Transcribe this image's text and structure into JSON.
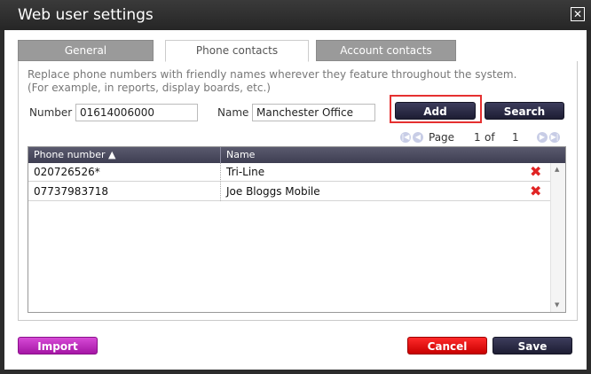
{
  "window": {
    "title": "Web user settings",
    "close_glyph": "☒"
  },
  "tabs": [
    {
      "label": "General"
    },
    {
      "label": "Phone contacts"
    },
    {
      "label": "Account contacts"
    }
  ],
  "intro": {
    "line1": "Replace phone numbers with friendly names wherever they feature throughout the system.",
    "line2": "(For example, in reports, display boards, etc.)"
  },
  "form": {
    "number_label": "Number",
    "number_value": "01614006000",
    "name_label": "Name",
    "name_value": "Manchester Office",
    "add_label": "Add",
    "search_label": "Search"
  },
  "pager": {
    "page_label": "Page",
    "current": "1",
    "of_label": "of",
    "total": "1"
  },
  "table": {
    "columns": [
      "Phone number ▲",
      "Name"
    ],
    "rows": [
      {
        "number": "020726526*",
        "name": "Tri-Line"
      },
      {
        "number": "07737983718",
        "name": "Joe Bloggs Mobile"
      }
    ]
  },
  "footer": {
    "import_label": "Import",
    "cancel_label": "Cancel",
    "save_label": "Save"
  },
  "colors": {
    "accent_red": "#e53030",
    "import_purple": "#c22cc2",
    "header_dark": "#3e3e52"
  }
}
